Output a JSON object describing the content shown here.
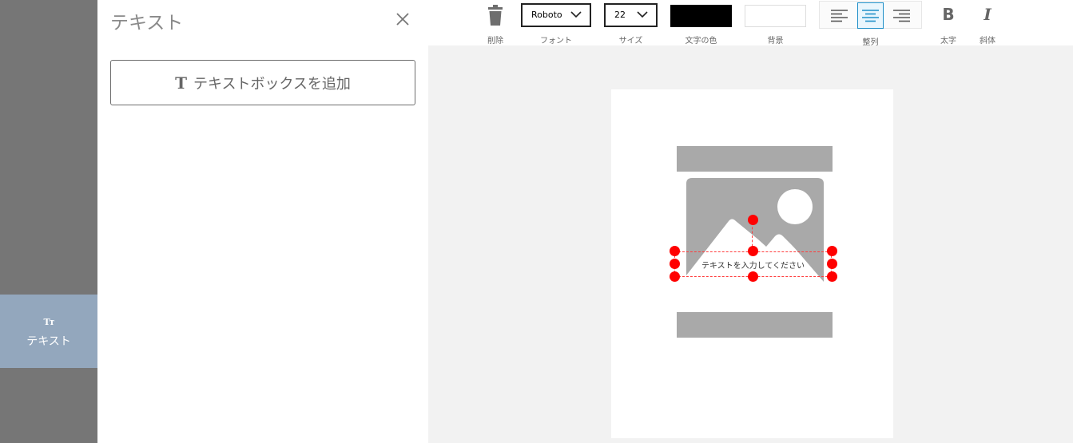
{
  "sidebar": {
    "items": [
      {
        "icon": "text-size-icon",
        "icon_glyph": "Tт",
        "label": "テキスト",
        "active": true
      }
    ]
  },
  "panel": {
    "title": "テキスト",
    "add_button_label": "テキストボックスを追加",
    "add_button_icon_glyph": "T"
  },
  "toolbar": {
    "delete_label": "削除",
    "font_label": "フォント",
    "font_value": "Roboto",
    "size_label": "サイズ",
    "size_value": "22",
    "text_color_label": "文字の色",
    "text_color_value": "#000000",
    "background_label": "背景",
    "background_value": "#ffffff",
    "align_label": "整列",
    "align_options": [
      "left",
      "center",
      "right"
    ],
    "align_selected": "center",
    "bold_label": "太字",
    "bold_glyph": "B",
    "italic_label": "斜体",
    "italic_glyph": "I"
  },
  "canvas": {
    "textbox_text": "テキストを入力してください",
    "image_placeholder_icon": "image-placeholder-icon"
  },
  "colors": {
    "rail": "#767676",
    "rail_active": "#93a7bd",
    "accent": "#1f8fc8",
    "selection": "#ff0000",
    "placeholder_gray": "#a9a9a9"
  }
}
